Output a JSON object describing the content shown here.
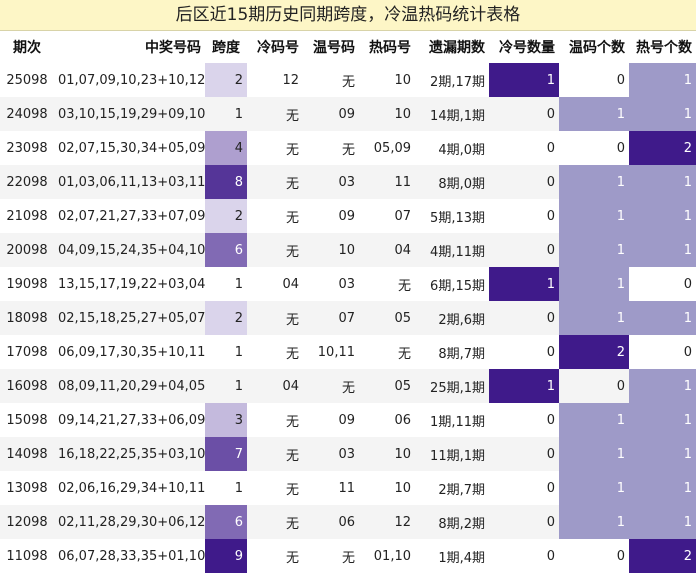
{
  "title": "后区近15期历史同期跨度，冷温热码统计表格",
  "headers": [
    "期次",
    "中奖号码",
    "跨度",
    "冷码号",
    "温号码",
    "热码号",
    "遗漏期数",
    "冷号数量",
    "温码个数",
    "热号个数"
  ],
  "rows": [
    {
      "period": "25098",
      "numbers": "01,07,09,10,23+10,12",
      "span": 2,
      "cold": "12",
      "warm": "无",
      "hot": "10",
      "miss": "2期,17期",
      "cold_count": 1,
      "warm_count": 0,
      "hot_count": 1
    },
    {
      "period": "24098",
      "numbers": "03,10,15,19,29+09,10",
      "span": 1,
      "cold": "无",
      "warm": "09",
      "hot": "10",
      "miss": "14期,1期",
      "cold_count": 0,
      "warm_count": 1,
      "hot_count": 1
    },
    {
      "period": "23098",
      "numbers": "02,07,15,30,34+05,09",
      "span": 4,
      "cold": "无",
      "warm": "无",
      "hot": "05,09",
      "miss": "4期,0期",
      "cold_count": 0,
      "warm_count": 0,
      "hot_count": 2
    },
    {
      "period": "22098",
      "numbers": "01,03,06,11,13+03,11",
      "span": 8,
      "cold": "无",
      "warm": "03",
      "hot": "11",
      "miss": "8期,0期",
      "cold_count": 0,
      "warm_count": 1,
      "hot_count": 1
    },
    {
      "period": "21098",
      "numbers": "02,07,21,27,33+07,09",
      "span": 2,
      "cold": "无",
      "warm": "09",
      "hot": "07",
      "miss": "5期,13期",
      "cold_count": 0,
      "warm_count": 1,
      "hot_count": 1
    },
    {
      "period": "20098",
      "numbers": "04,09,15,24,35+04,10",
      "span": 6,
      "cold": "无",
      "warm": "10",
      "hot": "04",
      "miss": "4期,11期",
      "cold_count": 0,
      "warm_count": 1,
      "hot_count": 1
    },
    {
      "period": "19098",
      "numbers": "13,15,17,19,22+03,04",
      "span": 1,
      "cold": "04",
      "warm": "03",
      "hot": "无",
      "miss": "6期,15期",
      "cold_count": 1,
      "warm_count": 1,
      "hot_count": 0
    },
    {
      "period": "18098",
      "numbers": "02,15,18,25,27+05,07",
      "span": 2,
      "cold": "无",
      "warm": "07",
      "hot": "05",
      "miss": "2期,6期",
      "cold_count": 0,
      "warm_count": 1,
      "hot_count": 1
    },
    {
      "period": "17098",
      "numbers": "06,09,17,30,35+10,11",
      "span": 1,
      "cold": "无",
      "warm": "10,11",
      "hot": "无",
      "miss": "8期,7期",
      "cold_count": 0,
      "warm_count": 2,
      "hot_count": 0
    },
    {
      "period": "16098",
      "numbers": "08,09,11,20,29+04,05",
      "span": 1,
      "cold": "04",
      "warm": "无",
      "hot": "05",
      "miss": "25期,1期",
      "cold_count": 1,
      "warm_count": 0,
      "hot_count": 1
    },
    {
      "period": "15098",
      "numbers": "09,14,21,27,33+06,09",
      "span": 3,
      "cold": "无",
      "warm": "09",
      "hot": "06",
      "miss": "1期,11期",
      "cold_count": 0,
      "warm_count": 1,
      "hot_count": 1
    },
    {
      "period": "14098",
      "numbers": "16,18,22,25,35+03,10",
      "span": 7,
      "cold": "无",
      "warm": "03",
      "hot": "10",
      "miss": "11期,1期",
      "cold_count": 0,
      "warm_count": 1,
      "hot_count": 1
    },
    {
      "period": "13098",
      "numbers": "02,06,16,29,34+10,11",
      "span": 1,
      "cold": "无",
      "warm": "11",
      "hot": "10",
      "miss": "2期,7期",
      "cold_count": 0,
      "warm_count": 1,
      "hot_count": 1
    },
    {
      "period": "12098",
      "numbers": "02,11,28,29,30+06,12",
      "span": 6,
      "cold": "无",
      "warm": "06",
      "hot": "12",
      "miss": "8期,2期",
      "cold_count": 0,
      "warm_count": 1,
      "hot_count": 1
    },
    {
      "period": "11098",
      "numbers": "06,07,28,33,35+01,10",
      "span": 9,
      "cold": "无",
      "warm": "无",
      "hot": "01,10",
      "miss": "1期,4期",
      "cold_count": 0,
      "warm_count": 0,
      "hot_count": 2
    }
  ],
  "colors": {
    "title_bg": "#fdf6c6",
    "alt_row_bg": "#f4f4f4",
    "span_min": "#f0eff9",
    "span_max": "#3f1a8a",
    "count_zero": "#ffffff",
    "count_one": "#9e9ac8",
    "count_two": "#3f1a8a"
  }
}
